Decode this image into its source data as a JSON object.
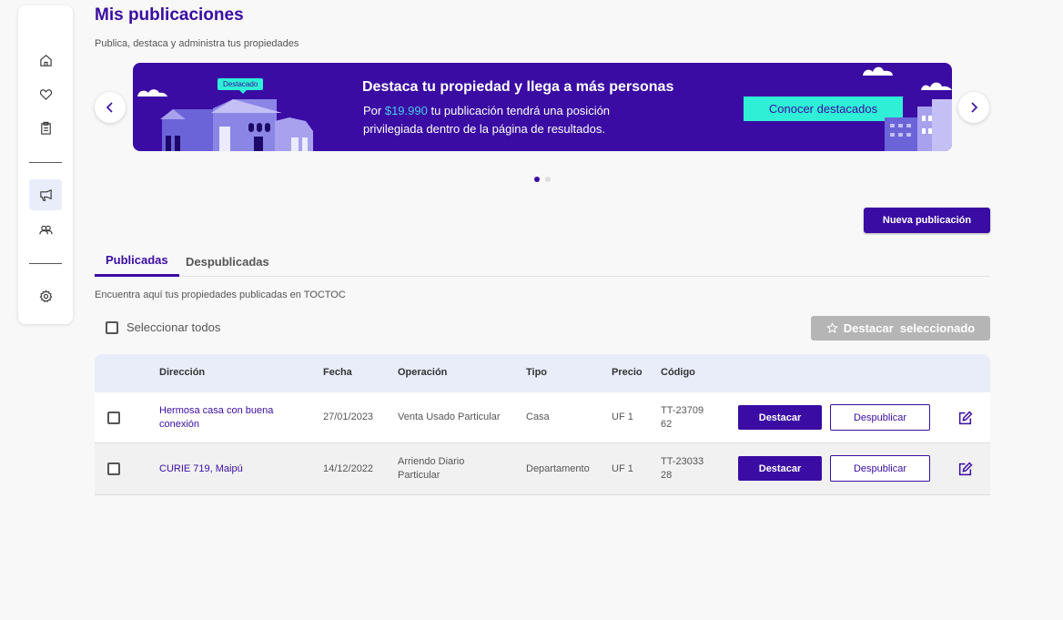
{
  "header": {
    "title": "Mis publicaciones",
    "subtitle": "Publica, destaca y administra tus propiedades"
  },
  "sidebar": {
    "items": [
      {
        "name": "home",
        "icon": "home-icon"
      },
      {
        "name": "favorites",
        "icon": "heart-icon"
      },
      {
        "name": "clipboard",
        "icon": "clipboard-icon"
      },
      {
        "name": "publications",
        "icon": "megaphone-icon",
        "active": true
      },
      {
        "name": "users",
        "icon": "users-icon"
      },
      {
        "name": "settings",
        "icon": "gear-icon"
      }
    ]
  },
  "banner": {
    "badge": "Destacado",
    "title": "Destaca tu propiedad y llega a más personas",
    "text_before": "Por ",
    "price": "$19.990",
    "text_after": " tu publicación tendrá una posición privilegiada dentro de la página de resultados.",
    "button": "Conocer destacados",
    "slides": 2,
    "active_slide": 1
  },
  "new_button": "Nueva publicación",
  "tabs": [
    {
      "label": "Publicadas",
      "active": true
    },
    {
      "label": "Despublicadas",
      "active": false
    }
  ],
  "info": "Encuentra aquí tus propiedades publicadas en TOCTOC",
  "select_all": "Seleccionar todos",
  "highlight_selected": "Destacar  seleccionado",
  "table": {
    "headers": [
      "Dirección",
      "Fecha",
      "Operación",
      "Tipo",
      "Precio",
      "Código"
    ],
    "rows": [
      {
        "address": "Hermosa casa con buena conexión",
        "date": "27/01/2023",
        "operation": "Venta Usado Particular",
        "type": "Casa",
        "price": "UF 1",
        "code": "TT-2370962"
      },
      {
        "address": "CURIE 719, Maipú",
        "date": "14/12/2022",
        "operation": "Arriendo Diario Particular",
        "type": "Departamento",
        "price": "UF 1",
        "code": "TT-2303328"
      }
    ],
    "action_highlight": "Destacar",
    "action_unpublish": "Despublicar"
  },
  "colors": {
    "primary": "#3a0ca3",
    "accent": "#2ff0d6",
    "price": "#4cc9f0",
    "header_bg": "#e8edf9"
  }
}
